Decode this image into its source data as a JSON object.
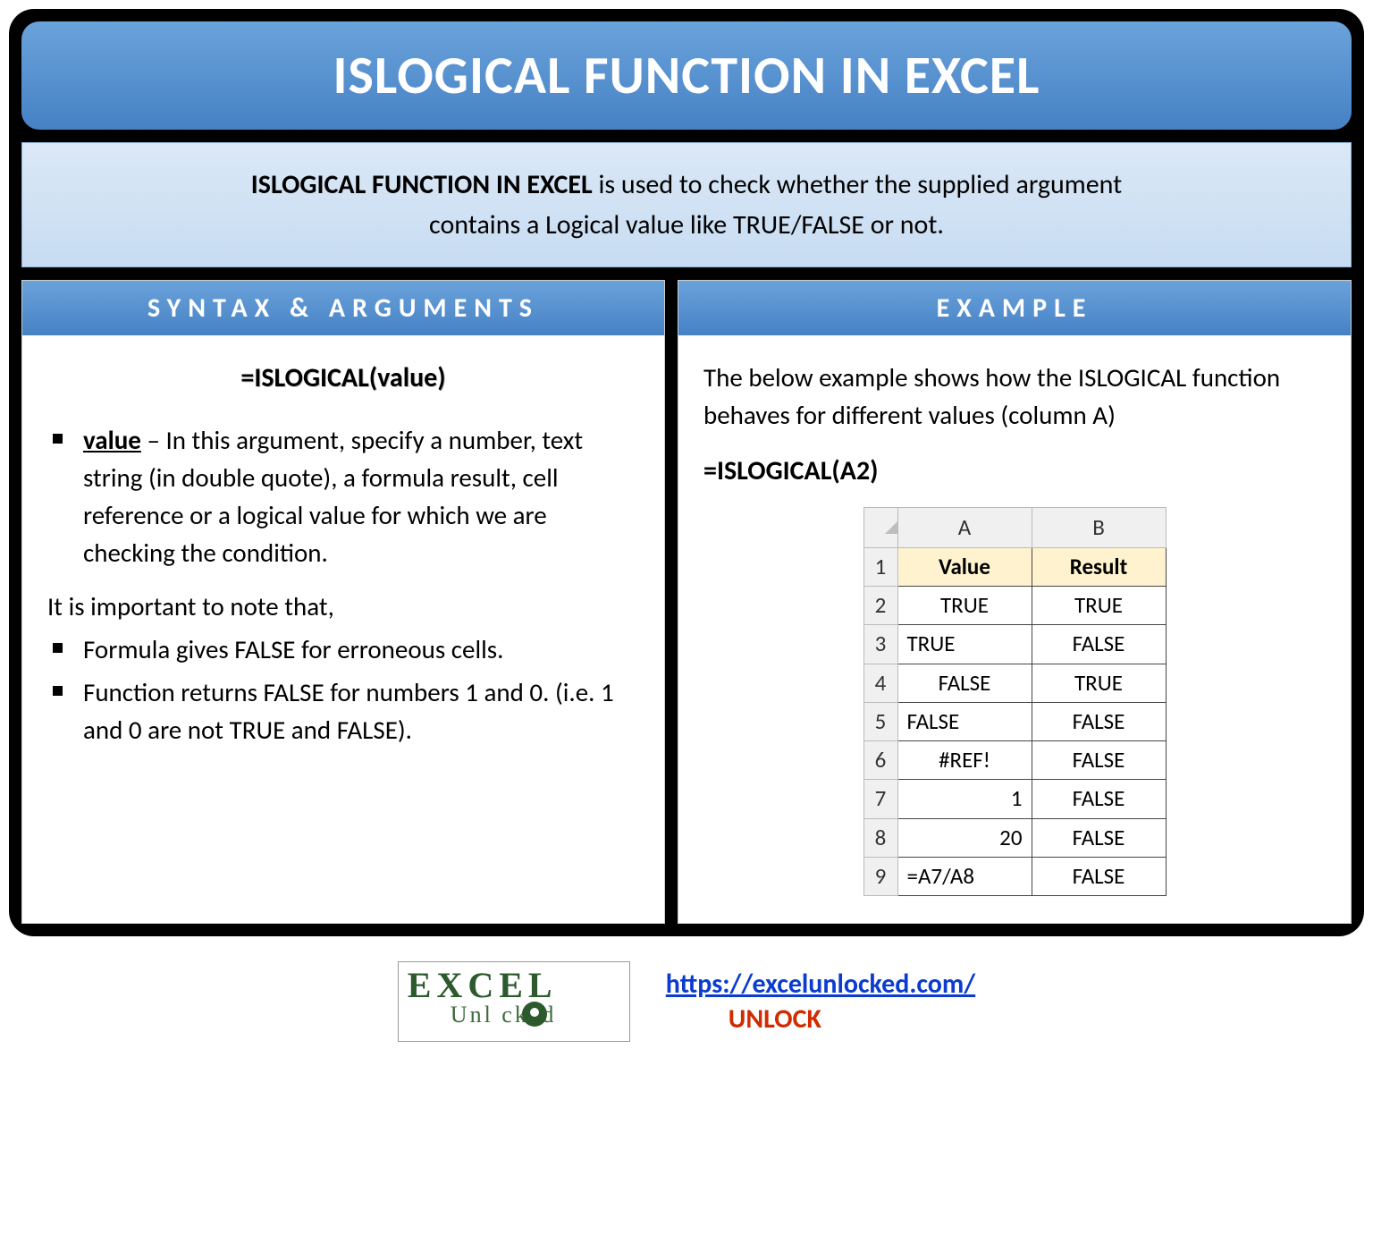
{
  "title": "ISLOGICAL FUNCTION IN EXCEL",
  "description": {
    "bold": "ISLOGICAL FUNCTION IN EXCEL",
    "rest_line1": " is used to check whether the supplied argument",
    "line2": "contains a Logical value like TRUE/FALSE or not."
  },
  "left": {
    "heading": "SYNTAX & ARGUMENTS",
    "formula": "=ISLOGICAL(value)",
    "arg_name": "value",
    "arg_desc": " – In this argument, specify a number, text string (in double quote), a formula result, cell reference or a logical value for which we are checking the condition.",
    "note_intro": "It is important to note that,",
    "note1": "Formula gives FALSE for erroneous cells.",
    "note2": "Function returns FALSE for numbers 1 and 0. (i.e. 1 and 0 are not TRUE and FALSE)."
  },
  "right": {
    "heading": "EXAMPLE",
    "intro": "The below example shows how the ISLOGICAL function behaves for different values (column A)",
    "formula": "=ISLOGICAL(A2)",
    "columns": {
      "A": "A",
      "B": "B"
    },
    "header": {
      "A": "Value",
      "B": "Result"
    },
    "rows": [
      {
        "n": "1",
        "A": "Value",
        "B": "Result",
        "isHeader": true
      },
      {
        "n": "2",
        "A": "TRUE",
        "B": "TRUE",
        "aA": "c"
      },
      {
        "n": "3",
        "A": "TRUE",
        "B": "FALSE",
        "aA": "l"
      },
      {
        "n": "4",
        "A": "FALSE",
        "B": "TRUE",
        "aA": "c"
      },
      {
        "n": "5",
        "A": "FALSE",
        "B": "FALSE",
        "aA": "l"
      },
      {
        "n": "6",
        "A": "#REF!",
        "B": "FALSE",
        "aA": "c"
      },
      {
        "n": "7",
        "A": "1",
        "B": "FALSE",
        "aA": "r"
      },
      {
        "n": "8",
        "A": "20",
        "B": "FALSE",
        "aA": "r"
      },
      {
        "n": "9",
        "A": "=A7/A8",
        "B": "FALSE",
        "aA": "l"
      }
    ]
  },
  "footer": {
    "logo_top": "EXCEL",
    "logo_bottom": "Unl  cked",
    "url": "https://excelunlocked.com/",
    "unlock": "UNLOCK"
  }
}
